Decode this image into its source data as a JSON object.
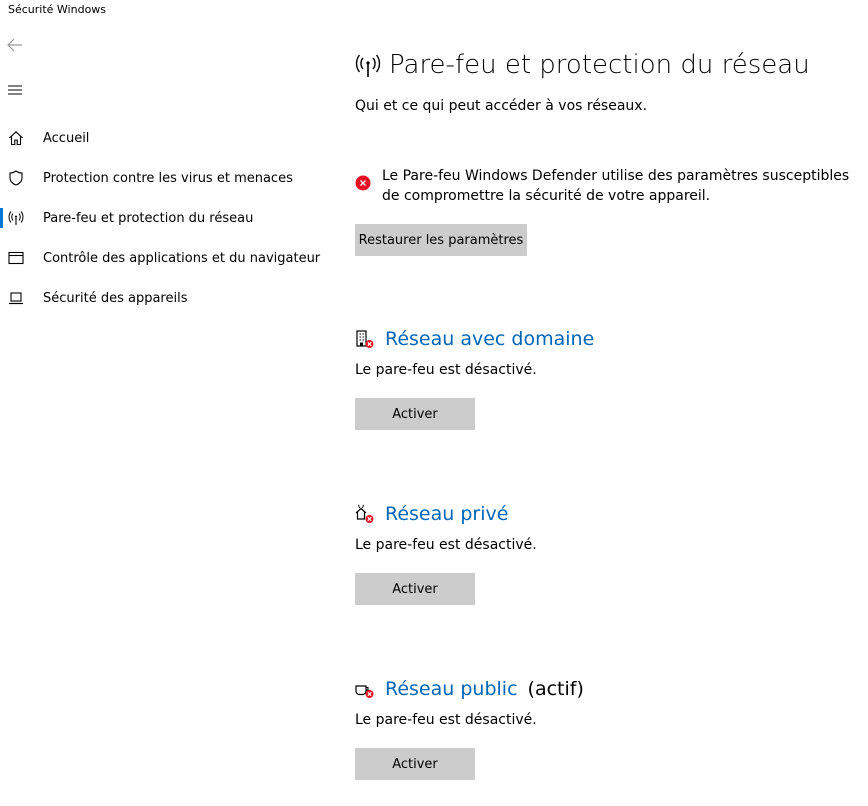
{
  "app": {
    "title": "Sécurité Windows"
  },
  "icons": {
    "back": "back-arrow-icon",
    "menu": "hamburger-menu-icon"
  },
  "sidebar": {
    "items": [
      {
        "label": "Accueil",
        "icon": "home-icon",
        "selected": false
      },
      {
        "label": "Protection contre les virus et menaces",
        "icon": "shield-icon",
        "selected": false
      },
      {
        "label": "Pare-feu et protection du réseau",
        "icon": "wireless-antenna-icon",
        "selected": true
      },
      {
        "label": "Contrôle des applications et du navigateur",
        "icon": "browser-window-icon",
        "selected": false
      },
      {
        "label": "Sécurité des appareils",
        "icon": "laptop-icon",
        "selected": false
      }
    ]
  },
  "main": {
    "title": "Pare-feu et protection du réseau",
    "subtitle": "Qui et ce qui peut accéder à vos réseaux.",
    "warning": {
      "text": "Le Pare-feu Windows Defender utilise des paramètres susceptibles de compromettre la sécurité de votre appareil.",
      "icon": "error-x-icon"
    },
    "restore_button": "Restaurer les paramètres",
    "sections": [
      {
        "title": "Réseau avec domaine",
        "active_label": "",
        "status": "Le pare-feu est désactivé.",
        "button": "Activer",
        "icon": "domain-network-icon"
      },
      {
        "title": "Réseau privé",
        "active_label": "",
        "status": "Le pare-feu est désactivé.",
        "button": "Activer",
        "icon": "private-network-icon"
      },
      {
        "title": "Réseau public",
        "active_label": "(actif)",
        "status": "Le pare-feu est désactivé.",
        "button": "Activer",
        "icon": "public-network-icon"
      }
    ]
  },
  "colors": {
    "accent": "#0078d7",
    "link": "#0067b8",
    "error": "#e81123",
    "button_bg": "#cccccc"
  }
}
